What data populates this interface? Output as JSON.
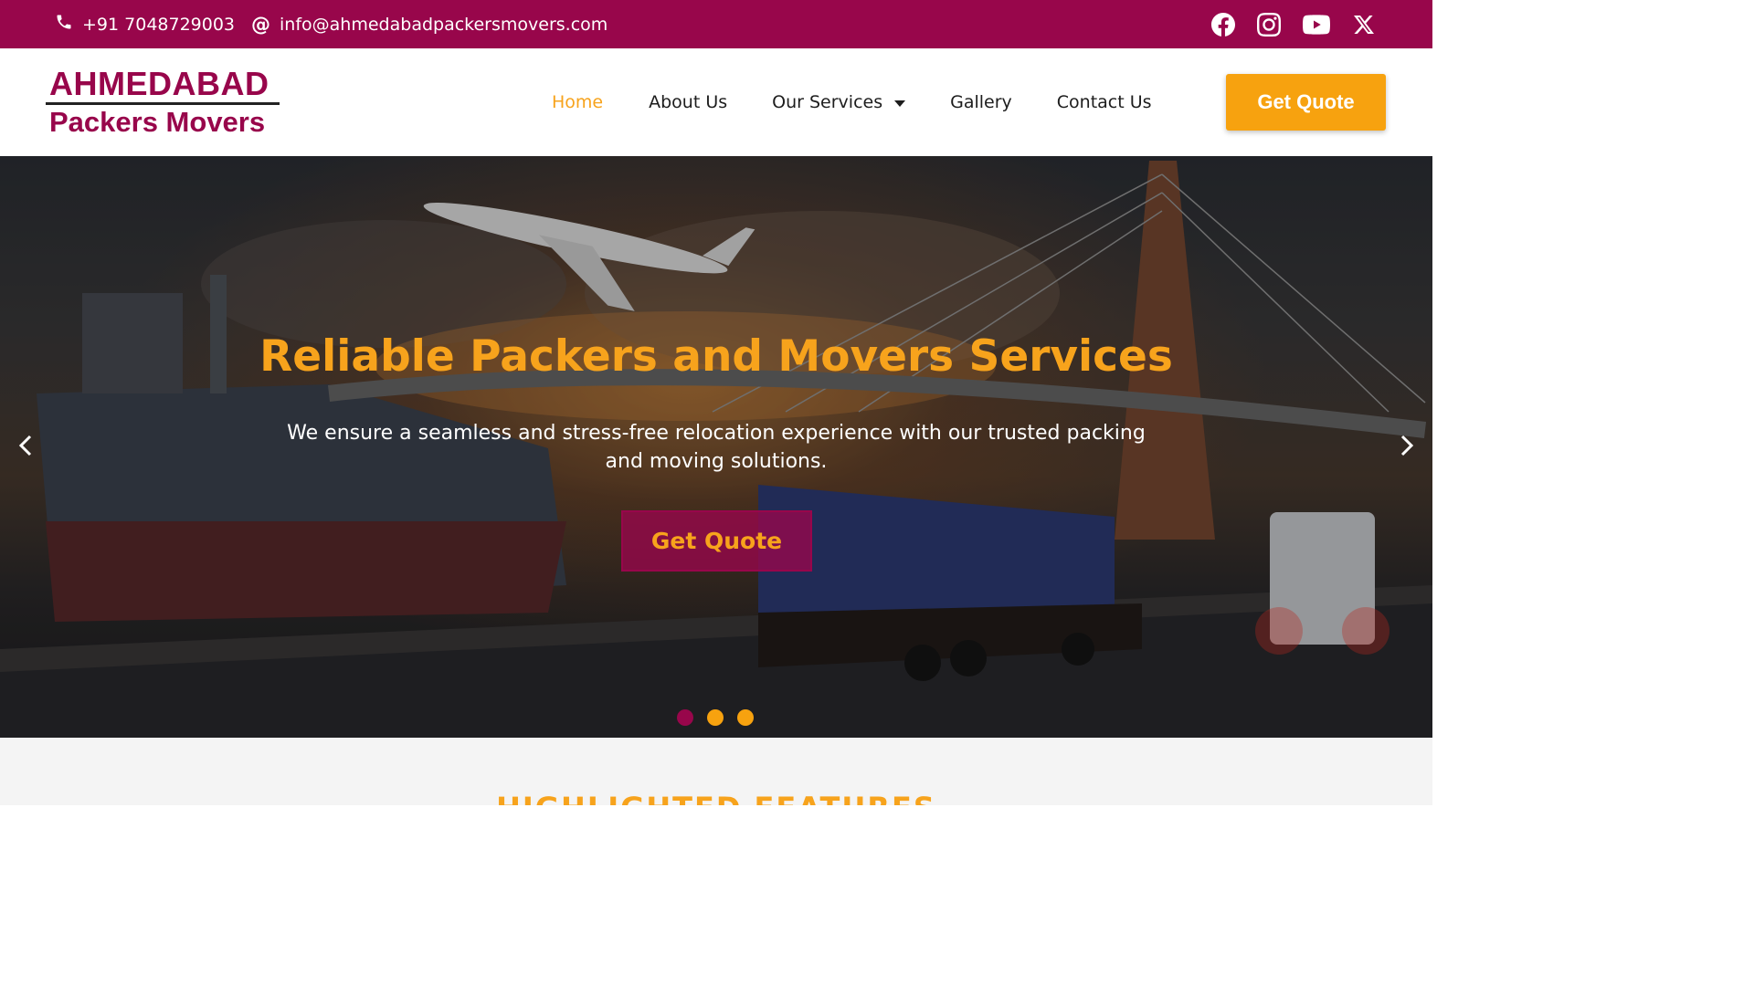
{
  "topbar": {
    "phone": "+91 7048729003",
    "email": "info@ahmedabadpackersmovers.com",
    "social": [
      "facebook-icon",
      "instagram-icon",
      "youtube-icon",
      "x-icon"
    ]
  },
  "logo": {
    "line1": "AHMEDABAD",
    "line2": "Packers Movers"
  },
  "nav": {
    "items": [
      "Home",
      "About Us",
      "Our Services",
      "Gallery",
      "Contact Us"
    ],
    "active": "Home",
    "cta": "Get Quote"
  },
  "hero": {
    "title": "Reliable Packers and Movers Services",
    "subtitle": "We ensure a seamless and stress-free relocation experience with our trusted packing and moving solutions.",
    "cta": "Get Quote",
    "slides": 3,
    "active_slide": 1
  },
  "features": {
    "title": "HIGHLIGHTED FEATURES"
  },
  "colors": {
    "brand": "#98064b",
    "accent": "#f7a31c"
  }
}
